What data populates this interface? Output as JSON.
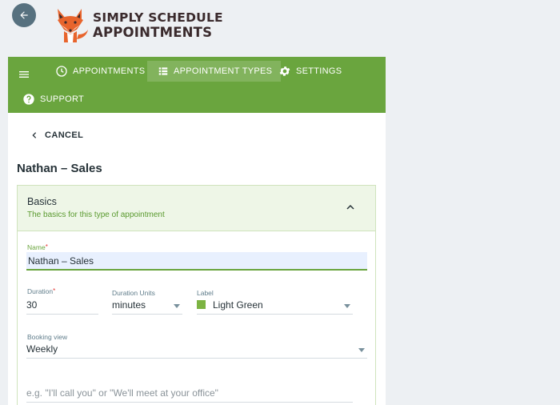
{
  "brand": {
    "line1": "SIMPLY SCHEDULE",
    "line2": "APPOINTMENTS"
  },
  "nav": {
    "items": [
      {
        "label": "APPOINTMENTS",
        "icon": "clock-icon"
      },
      {
        "label": "APPOINTMENT TYPES",
        "icon": "list-icon",
        "active": true
      },
      {
        "label": "SETTINGS",
        "icon": "gear-icon"
      },
      {
        "label": "SUPPORT",
        "icon": "help-icon"
      }
    ]
  },
  "cancel_label": "CANCEL",
  "page_title": "Nathan – Sales",
  "card": {
    "title": "Basics",
    "subtitle": "The basics for this type of appointment"
  },
  "form": {
    "name": {
      "label": "Name",
      "value": "Nathan – Sales"
    },
    "duration": {
      "label": "Duration",
      "value": "30"
    },
    "duration_units": {
      "label": "Duration Units",
      "value": "minutes"
    },
    "label": {
      "label": "Label",
      "value": "Light Green",
      "swatch_color": "#7cb342"
    },
    "booking_view": {
      "label": "Booking view",
      "value": "Weekly"
    },
    "location": {
      "placeholder": "e.g. \"I'll call you\" or \"We'll meet at your office\""
    }
  },
  "colors": {
    "primary": "#6aa53e",
    "card_header_bg": "#eef6e7",
    "back_button": "#57717f"
  }
}
